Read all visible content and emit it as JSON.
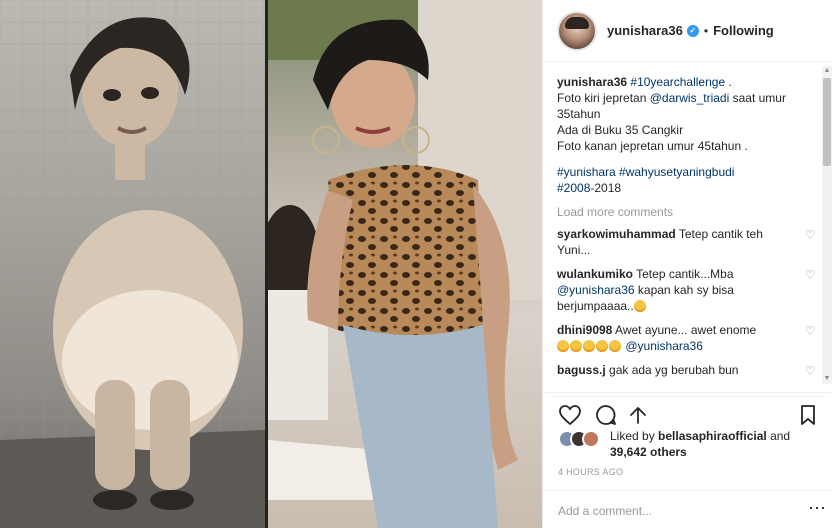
{
  "post": {
    "username": "yunishara36",
    "following_label": "Following",
    "separator": "•"
  },
  "caption": {
    "username": "yunishara36",
    "lines": [
      {
        "pre": "",
        "link": "#10yearchallenge",
        "post": " ."
      },
      {
        "pre": "Foto kiri jepretan ",
        "link": "@darwis_triadi",
        "post": " saat umur"
      },
      {
        "pre": "35tahun",
        "link": "",
        "post": ""
      },
      {
        "pre": "Ada di Buku 35 Cangkir",
        "link": "",
        "post": ""
      },
      {
        "pre": "Foto kanan jepretan umur 45tahun .",
        "link": "",
        "post": ""
      }
    ],
    "hashtags_line1": "#yunishara #wahyusetyaningbudi",
    "hashtags_line2_link": "#2008",
    "hashtags_line2_post": "-2018"
  },
  "load_more": "Load more comments",
  "comments": [
    {
      "user": "syarkowimuhammad",
      "text": " Tetep cantik teh Yuni..."
    },
    {
      "user": "wulankumiko",
      "text": " Tetep cantik...Mba",
      "mention": "@yunishara36",
      "text2": " kapan kah sy bisa berjumpaaaa..",
      "emoji_count": 1
    },
    {
      "user": "dhini9098",
      "text": " Awet ayune... awet enome",
      "emoji_count": 5,
      "mention": "@yunishara36"
    },
    {
      "user": "baguss.j",
      "text": " gak ada yg berubah bun"
    }
  ],
  "likes": {
    "prefix": "Liked by ",
    "user": "bellasaphiraofficial",
    "mid": " and",
    "count": "39,642 others"
  },
  "timestamp": "4 HOURS AGO",
  "add_comment": {
    "placeholder": "Add a comment..."
  },
  "more_label": "•••",
  "colors": {
    "link": "#003569",
    "verified": "#3897f0",
    "muted": "#999999"
  }
}
